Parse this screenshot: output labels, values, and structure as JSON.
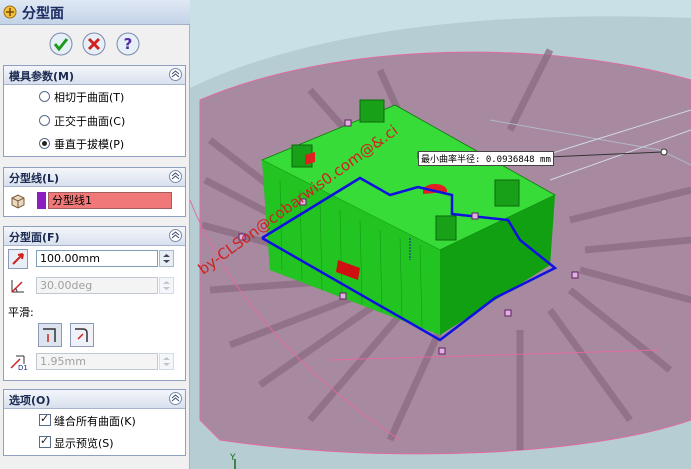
{
  "panel": {
    "title": "分型面",
    "mold_params": {
      "header": "模具参数(M)",
      "options": [
        "相切于曲面(T)",
        "正交于曲面(C)",
        "垂直于拔模(P)"
      ],
      "selected_index": 2
    },
    "parting_line": {
      "header": "分型线(L)",
      "item": "分型线1"
    },
    "parting_surface": {
      "header": "分型面(F)",
      "distance": "100.00mm",
      "angle": "30.00deg",
      "smooth_label": "平滑:",
      "smooth_distance": "1.95mm"
    },
    "options": {
      "header": "选项(O)",
      "checks": [
        {
          "label": "缝合所有曲面(K)",
          "checked": true
        },
        {
          "label": "显示预览(S)",
          "checked": true
        }
      ]
    }
  },
  "viewport": {
    "annotation": "最小曲率半径: 0.0936848 mm",
    "watermark": "by-CLSon@cobarwis0.com@&.ci",
    "axis_label": "Y",
    "colors": {
      "model": "#1ec81e",
      "parting_line": "#1010e0",
      "surface": "#9a7a92",
      "background": "#c8e0e6"
    }
  }
}
